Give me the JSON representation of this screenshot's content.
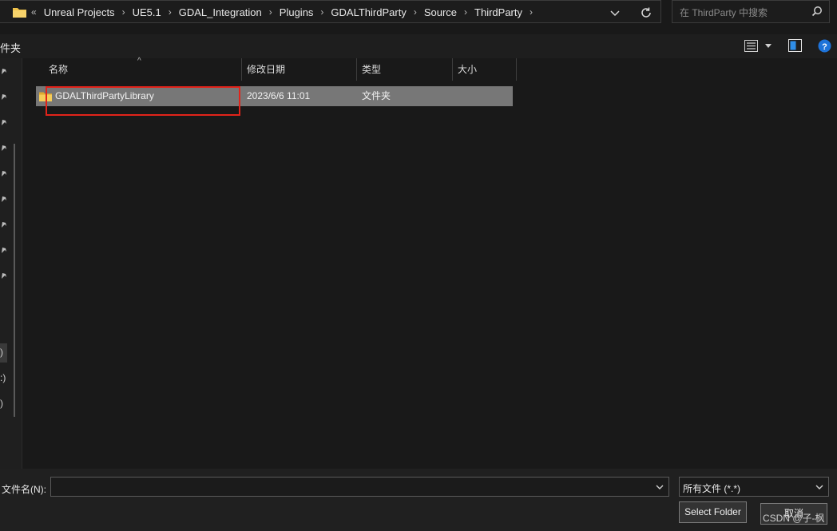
{
  "address": {
    "overflow": "«",
    "path": [
      "Unreal Projects",
      "UE5.1",
      "GDAL_Integration",
      "Plugins",
      "GDALThirdParty",
      "Source",
      "ThirdParty"
    ]
  },
  "search": {
    "placeholder": "在 ThirdParty 中搜索"
  },
  "toolbar": {
    "label": "件夹"
  },
  "nav": {
    "marks": [
      ")",
      ":)",
      ")"
    ]
  },
  "columns": {
    "name": "名称",
    "date": "修改日期",
    "type": "类型",
    "size": "大小"
  },
  "files": [
    {
      "name": "GDALThirdPartyLibrary",
      "date": "2023/6/6 11:01",
      "type": "文件夹",
      "size": ""
    }
  ],
  "bottom": {
    "filename_label": "文件名(N):",
    "filename_value": "",
    "filetype_value": "所有文件 (*.*)",
    "select_label": "Select Folder",
    "cancel_label": "取消"
  },
  "watermark": "CSDN @子-枫",
  "colors": {
    "folder": "#f0c24a",
    "highlight": "#e2231a",
    "help": "#1e73d9",
    "selected_row": "#777777"
  }
}
